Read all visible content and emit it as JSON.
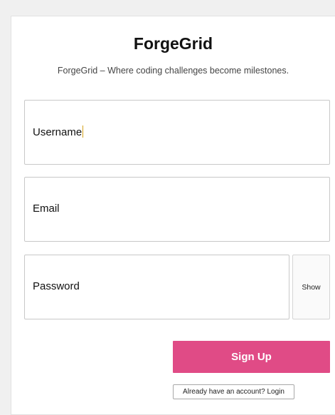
{
  "app": {
    "title": "ForgeGrid",
    "tagline": "ForgeGrid – Where coding challenges become milestones."
  },
  "form": {
    "username_label": "Username",
    "email_label": "Email",
    "password_label": "Password",
    "show_label": "Show",
    "signup_label": "Sign Up",
    "login_label": "Already have an account? Login"
  },
  "colors": {
    "accent": "#e04b86",
    "caret": "#d6a21c"
  }
}
